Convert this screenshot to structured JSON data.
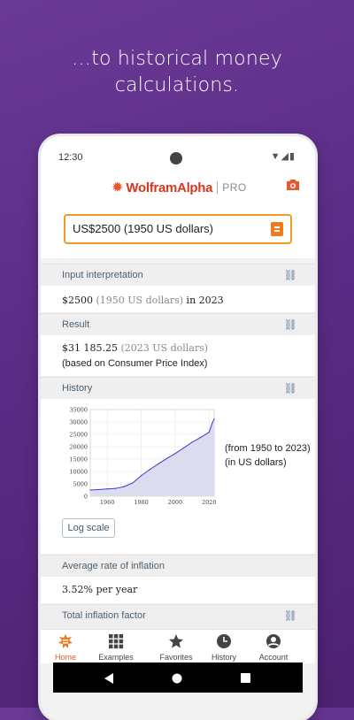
{
  "promo": {
    "line1": "…to historical money",
    "line2": "calculations."
  },
  "status": {
    "time": "12:30"
  },
  "app": {
    "brand": "WolframAlpha",
    "tier": "PRO"
  },
  "search": {
    "value": "US$2500 (1950 US dollars)"
  },
  "pods": {
    "input": {
      "title": "Input interpretation",
      "amount": "$2500",
      "unit": "(1950 US dollars)",
      "in": "in",
      "year": "2023"
    },
    "result": {
      "title": "Result",
      "amount": "$31 185.25",
      "unit": "(2023 US dollars)",
      "note": "(based on Consumer Price Index)"
    },
    "history": {
      "title": "History",
      "note1": "(from 1950 to 2023)",
      "note2": "(in US dollars)",
      "log_button": "Log scale"
    },
    "inflation": {
      "title": "Average rate of inflation",
      "value": "3.52% per year"
    },
    "factor": {
      "title": "Total inflation factor"
    }
  },
  "nav": [
    {
      "label": "Home",
      "icon": "home-icon"
    },
    {
      "label": "Examples",
      "icon": "grid-icon"
    },
    {
      "label": "Favorites",
      "icon": "star-icon"
    },
    {
      "label": "History",
      "icon": "clock-icon"
    },
    {
      "label": "Account",
      "icon": "account-icon"
    }
  ],
  "chart_data": {
    "type": "area",
    "x": [
      1950,
      1955,
      1960,
      1965,
      1970,
      1975,
      1980,
      1985,
      1990,
      1995,
      2000,
      2005,
      2010,
      2015,
      2020,
      2022,
      2023
    ],
    "values": [
      2500,
      2690,
      2960,
      3150,
      3880,
      5380,
      8250,
      10760,
      13020,
      15210,
      17200,
      19500,
      21820,
      23720,
      25820,
      29800,
      31185
    ],
    "xticks": [
      "1960",
      "1980",
      "2000",
      "2020"
    ],
    "yticks": [
      "0",
      "5000",
      "10000",
      "15000",
      "20000",
      "25000",
      "30000",
      "35000"
    ],
    "xlim": [
      1950,
      2023
    ],
    "ylim": [
      0,
      35000
    ],
    "line_color": "#3a3ad0",
    "fill_color": "#dcdcef"
  }
}
